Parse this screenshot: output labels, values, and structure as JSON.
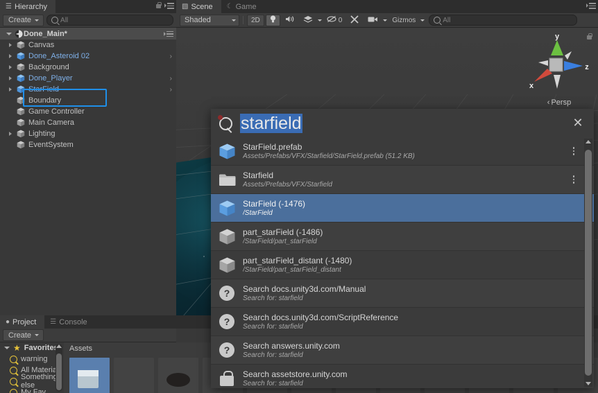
{
  "hierarchy": {
    "tab_label": "Hierarchy",
    "tab_icon": "hierarchy-icon",
    "create_label": "Create",
    "search_placeholder": "All",
    "scene_name": "Done_Main*",
    "items": [
      {
        "label": "Canvas",
        "prefab": false,
        "twisty": "closed",
        "chevron": false,
        "depth": 1
      },
      {
        "label": "Done_Asteroid 02",
        "prefab": true,
        "twisty": "closed",
        "chevron": true,
        "depth": 1
      },
      {
        "label": "Background",
        "prefab": false,
        "twisty": "closed",
        "chevron": false,
        "depth": 1
      },
      {
        "label": "Done_Player",
        "prefab": true,
        "twisty": "closed",
        "chevron": true,
        "depth": 1
      },
      {
        "label": "StarField",
        "prefab": true,
        "twisty": "closed",
        "chevron": true,
        "depth": 1,
        "highlighted": true
      },
      {
        "label": "Boundary",
        "prefab": false,
        "twisty": "none",
        "chevron": false,
        "depth": 1
      },
      {
        "label": "Game Controller",
        "prefab": false,
        "twisty": "none",
        "chevron": false,
        "depth": 1
      },
      {
        "label": "Main Camera",
        "prefab": false,
        "twisty": "none",
        "chevron": false,
        "depth": 1
      },
      {
        "label": "Lighting",
        "prefab": false,
        "twisty": "closed",
        "chevron": false,
        "depth": 1
      },
      {
        "label": "EventSystem",
        "prefab": false,
        "twisty": "none",
        "chevron": false,
        "depth": 1
      }
    ],
    "highlight_color": "#1f8fe8",
    "prefab_color": "#7fb0e8"
  },
  "scene": {
    "tabs": [
      {
        "label": "Scene",
        "icon": "scene-grid-icon",
        "active": true
      },
      {
        "label": "Game",
        "icon": "game-moon-icon",
        "active": false
      }
    ],
    "toolbar": {
      "draw_mode": "Shaded",
      "mode_2d": "2D",
      "lighting_icon": "lightbulb-icon",
      "audio_icon": "speaker-icon",
      "fx_icon": "effects-layers-icon",
      "hidden_count": "0",
      "hidden_icon": "eye-slash-icon",
      "tools_icon": "tools-icon",
      "camera_icon": "camera-icon",
      "gizmos_label": "Gizmos",
      "search_placeholder": "All"
    },
    "gizmo": {
      "axis_y": "y",
      "axis_x": "x",
      "axis_z": "z",
      "projection": "Persp",
      "lock_icon": "lock-icon",
      "color_x": "#d04a3c",
      "color_y": "#6cc041",
      "color_z": "#3a7fe0"
    }
  },
  "search_overlay": {
    "query": "starfield",
    "magnifier_icon": "search-icon",
    "close_icon": "close-icon",
    "results": [
      {
        "title": "StarField.prefab",
        "subtitle": "Assets/Prefabs/VFX/Starfield/StarField.prefab (51.2 KB)",
        "icon": "prefab-cube-icon",
        "selected": false,
        "kebab": true
      },
      {
        "title": "Starfield",
        "subtitle": "Assets/Prefabs/VFX/Starfield",
        "icon": "folder-icon",
        "selected": false,
        "kebab": true
      },
      {
        "title": "StarField (-1476)",
        "subtitle": "/StarField",
        "icon": "prefab-cube-icon",
        "selected": true,
        "kebab": false
      },
      {
        "title": "part_starField (-1486)",
        "subtitle": "/StarField/part_starField",
        "icon": "gameobject-cube-icon",
        "selected": false,
        "kebab": false
      },
      {
        "title": "part_starField_distant (-1480)",
        "subtitle": "/StarField/part_starField_distant",
        "icon": "gameobject-cube-icon",
        "selected": false,
        "kebab": false
      },
      {
        "title": "Search docs.unity3d.com/Manual",
        "subtitle": "Search for: starfield",
        "icon": "question-mark-icon",
        "selected": false,
        "kebab": false
      },
      {
        "title": "Search docs.unity3d.com/ScriptReference",
        "subtitle": "Search for: starfield",
        "icon": "question-mark-icon",
        "selected": false,
        "kebab": false
      },
      {
        "title": "Search answers.unity.com",
        "subtitle": "Search for: starfield",
        "icon": "question-mark-icon",
        "selected": false,
        "kebab": false
      },
      {
        "title": "Search assetstore.unity.com",
        "subtitle": "Search for: starfield",
        "icon": "asset-store-bag-icon",
        "selected": false,
        "kebab": false
      }
    ],
    "selection_color": "#4b6f9c",
    "text_highlight_color": "#3a6cb4"
  },
  "project": {
    "tabs": [
      {
        "label": "Project",
        "icon": "project-icon",
        "active": true
      },
      {
        "label": "Console",
        "icon": "console-icon",
        "active": false
      }
    ],
    "create_label": "Create",
    "favorites_label": "Favorites",
    "favorites": [
      {
        "label": "warning"
      },
      {
        "label": "All Materials"
      },
      {
        "label": "Something else"
      },
      {
        "label": "My Fav"
      }
    ],
    "breadcrumb": "Assets"
  }
}
